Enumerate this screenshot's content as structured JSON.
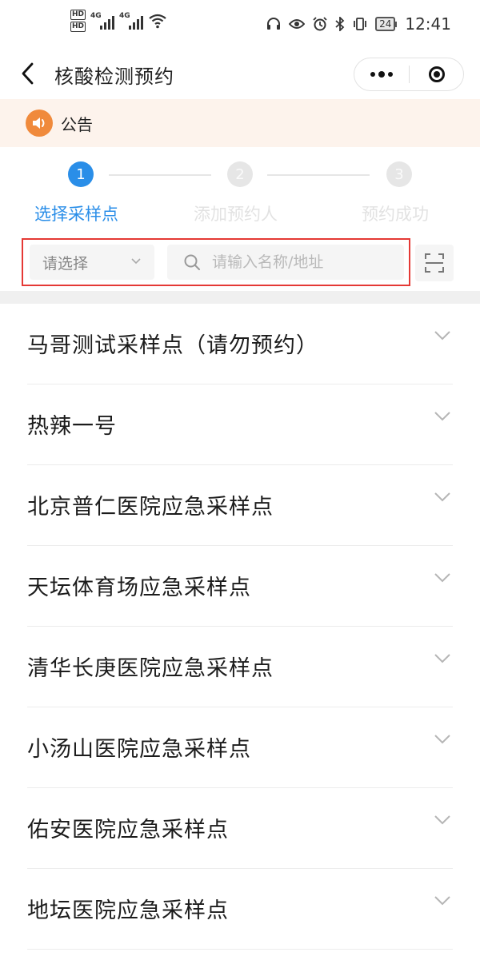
{
  "status_bar": {
    "left_badges": [
      "HD",
      "HD"
    ],
    "signal_label_1": "4G",
    "signal_label_2": "4G",
    "battery": "24",
    "time": "12:41",
    "icons": [
      "headphones-icon",
      "eye-icon",
      "alarm-icon",
      "bluetooth-icon",
      "vibrate-icon",
      "battery-icon"
    ]
  },
  "nav": {
    "title": "核酸检测预约",
    "back_icon": "chevron-left-icon",
    "more_icon": "more-dots-icon",
    "close_icon": "target-close-icon"
  },
  "notice": {
    "label": "公告",
    "icon": "speaker-icon",
    "accent": "#f08a3c",
    "background": "#fdf3ec"
  },
  "steps": [
    {
      "number": "1",
      "label": "选择采样点",
      "state": "active"
    },
    {
      "number": "2",
      "label": "添加预约人",
      "state": "inactive"
    },
    {
      "number": "3",
      "label": "预约成功",
      "state": "inactive"
    }
  ],
  "filter": {
    "select_placeholder": "请选择",
    "search_placeholder": "请输入名称/地址",
    "search_value": "",
    "scan_icon": "scan-icon",
    "highlight_color": "#e53935"
  },
  "accent_color": "#2a8ee8",
  "sites": [
    {
      "name": "马哥测试采样点（请勿预约）"
    },
    {
      "name": "热辣一号"
    },
    {
      "name": "北京普仁医院应急采样点"
    },
    {
      "name": "天坛体育场应急采样点"
    },
    {
      "name": "清华长庚医院应急采样点"
    },
    {
      "name": "小汤山医院应急采样点"
    },
    {
      "name": "佑安医院应急采样点"
    },
    {
      "name": "地坛医院应急采样点"
    }
  ]
}
